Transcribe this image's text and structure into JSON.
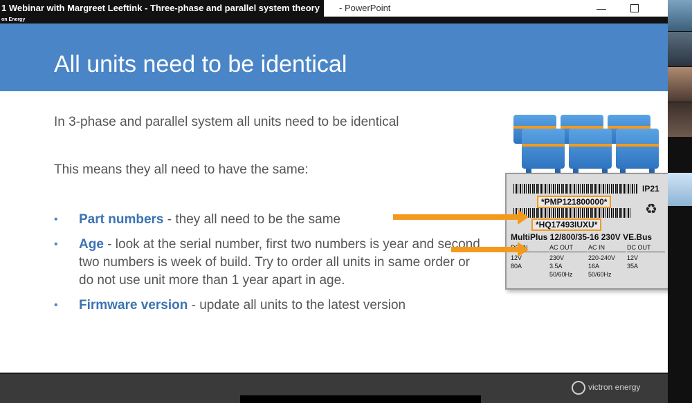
{
  "window": {
    "title": "1 Webinar with Margreet Leeftink - Three-phase and parallel system theory",
    "app": "- PowerPoint",
    "brand_strip": "on Energy",
    "minimize_symbol": "—"
  },
  "slide": {
    "title": "All units need to be identical",
    "intro": "In 3-phase and parallel system all units need to be identical",
    "means": "This means they all need to have the same:",
    "bullets": [
      {
        "key": "Part numbers",
        "text": " - they all need to be the same"
      },
      {
        "key": "Age",
        "text": " - look at the serial number, first two numbers is year and second two numbers is week of build. Try to order all units in same order or do not use unit more than 1 year apart in age."
      },
      {
        "key": "Firmware version",
        "text": " - update all units to the latest version"
      }
    ],
    "bullet_symbol": "•"
  },
  "label": {
    "ip": "IP21",
    "part_number": "*PMP121800000*",
    "serial_number": "*HQ17493IUXU*",
    "model": "MultiPlus 12/800/35-16 230V VE.Bus",
    "weee_symbol": "♻",
    "columns": [
      {
        "header": "DC IN",
        "lines": [
          "12V",
          "80A"
        ]
      },
      {
        "header": "AC OUT",
        "lines": [
          "230V",
          "3.5A",
          "50/60Hz"
        ]
      },
      {
        "header": "AC IN",
        "lines": [
          "220-240V",
          "16A",
          "50/60Hz"
        ]
      },
      {
        "header": "DC OUT",
        "lines": [
          "12V",
          "35A"
        ]
      }
    ]
  },
  "footer": {
    "logo_text": "victron energy"
  },
  "colors": {
    "banner": "#4a86c7",
    "accent_orange": "#f39a1e",
    "bullet_key": "#3b73b2"
  },
  "icons": {
    "minimize": "minimize-icon",
    "maximize": "maximize-icon",
    "recycle": "weee-icon",
    "logo": "victron-logo-icon"
  }
}
